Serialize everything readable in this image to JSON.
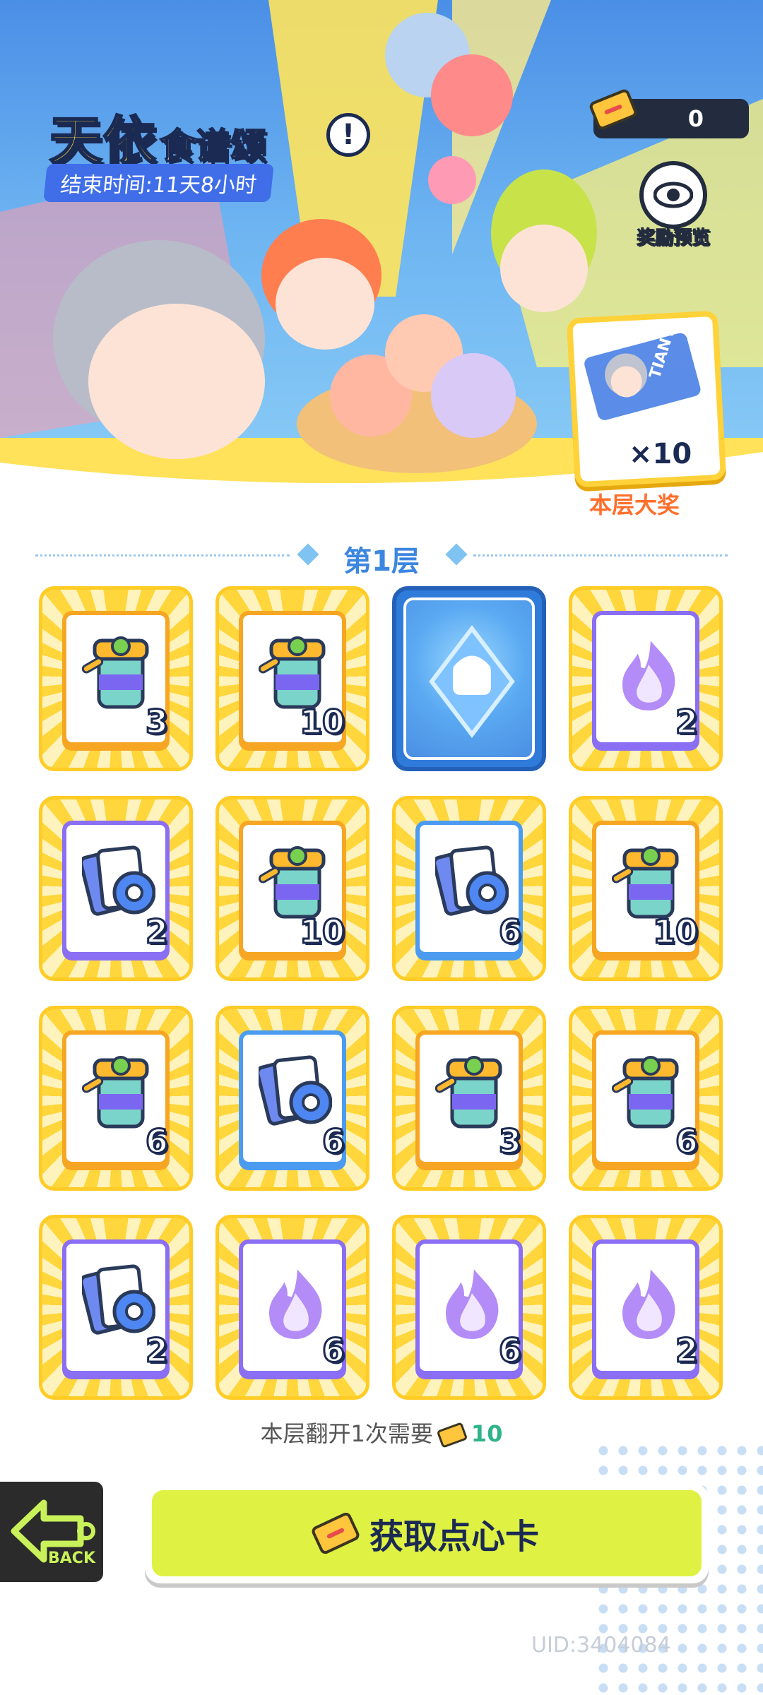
{
  "event": {
    "title_main": "天依",
    "title_sub": "食谱颂",
    "info_label": "!",
    "timer": "结束时间:11天8小时",
    "currency_count": "0",
    "preview_label": "奖励预览",
    "grand_prize": {
      "multiplier": "×10",
      "label": "本层大奖",
      "card_text": "TIANYI"
    }
  },
  "layer": {
    "title": "第1层"
  },
  "tiles": [
    {
      "type": "jar",
      "qty": "3",
      "frame": "orange"
    },
    {
      "type": "jar",
      "qty": "10",
      "frame": "orange"
    },
    {
      "type": "revealed",
      "qty": "",
      "frame": "revealed"
    },
    {
      "type": "flame",
      "qty": "2",
      "frame": "purple"
    },
    {
      "type": "cards",
      "qty": "2",
      "frame": "purple"
    },
    {
      "type": "jar",
      "qty": "10",
      "frame": "orange"
    },
    {
      "type": "cards",
      "qty": "6",
      "frame": "blue"
    },
    {
      "type": "jar",
      "qty": "10",
      "frame": "orange"
    },
    {
      "type": "jar",
      "qty": "6",
      "frame": "orange"
    },
    {
      "type": "cards",
      "qty": "6",
      "frame": "blue"
    },
    {
      "type": "jar",
      "qty": "3",
      "frame": "orange"
    },
    {
      "type": "jar",
      "qty": "6",
      "frame": "orange"
    },
    {
      "type": "cards",
      "qty": "2",
      "frame": "purple"
    },
    {
      "type": "flame",
      "qty": "6",
      "frame": "purple"
    },
    {
      "type": "flame",
      "qty": "6",
      "frame": "purple"
    },
    {
      "type": "flame",
      "qty": "2",
      "frame": "purple"
    }
  ],
  "footer": {
    "cost_text": "本层翻开1次需要",
    "cost_value": "10",
    "get_button": "获取点心卡",
    "back_label": "BACK",
    "uid": "UID:3404084"
  },
  "colors": {
    "accent": "#3b86df",
    "button": "#dff142",
    "gold": "#ffd63b",
    "purple": "#8a6ef3",
    "orange": "#f6a623"
  }
}
